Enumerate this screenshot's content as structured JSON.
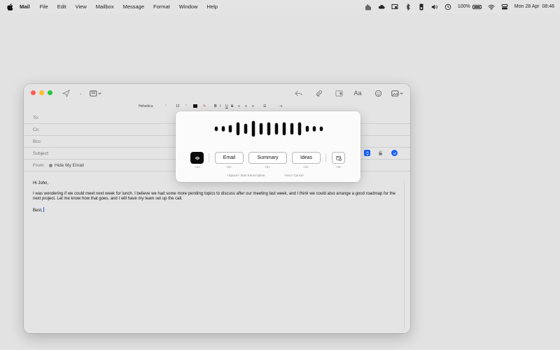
{
  "menubar": {
    "items": [
      "Mail",
      "File",
      "Edit",
      "View",
      "Mailbox",
      "Message",
      "Format",
      "Window",
      "Help"
    ],
    "battery": "100%",
    "datetime": "Mon 28 Apr  08:46"
  },
  "formatbar": {
    "font": "Helvetica",
    "size": "12",
    "bold": "B",
    "italic": "I",
    "underline": "U",
    "strike": "S"
  },
  "compose": {
    "to_label": "To:",
    "cc_label": "Cc:",
    "bcc_label": "Bcc:",
    "subject_label": "Subject:",
    "from_label": "From:",
    "from_value": "Hide My Email",
    "greeting": "Hi John,",
    "paragraph": "I was wondering if we could meet next week for lunch. I believe we had some more pending topics to discuss after our meeting last week, and I think we could also arrange a good roadmap for the next project. Let me know how that goes, and I will have my team set up the call.",
    "signoff": "Best,"
  },
  "popover": {
    "email_label": "Email",
    "summary_label": "Summary",
    "ideas_label": "Ideas",
    "keys": [
      "<1>",
      "<2>",
      "<3>",
      "<4>",
      "<5>"
    ],
    "hint_start": "<Space> Start transcription",
    "hint_cancel": "<esc> Cancel"
  },
  "icons": {
    "apple": "apple-icon",
    "send": "send-icon",
    "header_fields": "header-fields-icon",
    "reply": "reply-icon",
    "attach": "paperclip-icon",
    "photo_browser": "photo-browser-icon",
    "fonts": "fonts-icon",
    "emoji": "emoji-icon",
    "photo": "photo-icon",
    "mic": "waveform-icon",
    "calendar": "calendar-icon"
  },
  "colors": {
    "close": "#fe5f57",
    "minimize": "#febc2e",
    "maximize": "#28c840",
    "accent": "#1a60f5"
  }
}
